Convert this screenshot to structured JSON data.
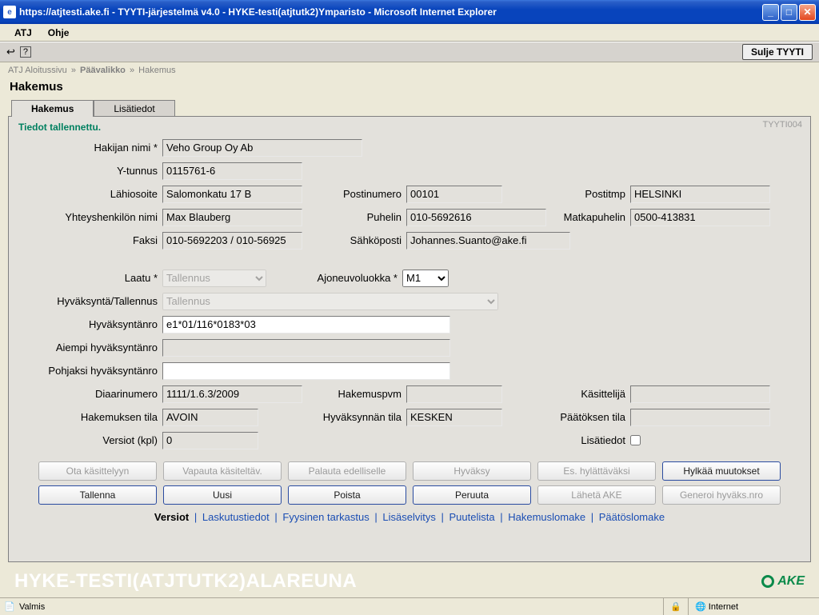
{
  "window": {
    "title": "https://atjtesti.ake.fi - TYYTI-järjestelmä v4.0 - HYKE-testi(atjtutk2)Ymparisto - Microsoft Internet Explorer"
  },
  "menu": {
    "atj": "ATJ",
    "ohje": "Ohje"
  },
  "toolbar": {
    "sulje": "Sulje TYYTI"
  },
  "breadcrumb": {
    "a": "ATJ Aloitussivu",
    "b": "Päävalikko",
    "c": "Hakemus"
  },
  "page": {
    "title": "Hakemus"
  },
  "tabs": {
    "hakemus": "Hakemus",
    "lisatiedot": "Lisätiedot"
  },
  "panel": {
    "status": "Tiedot tallennettu.",
    "id": "TYYTI004"
  },
  "labels": {
    "hakijan_nimi": "Hakijan nimi *",
    "ytunnus": "Y-tunnus",
    "lahiosoite": "Lähiosoite",
    "postinumero": "Postinumero",
    "postitmp": "Postitmp",
    "yhteyshenkilo": "Yhteyshenkilön nimi",
    "puhelin": "Puhelin",
    "matkapuhelin": "Matkapuhelin",
    "faksi": "Faksi",
    "sahkoposti": "Sähköposti",
    "laatu": "Laatu *",
    "ajoneuvoluokka": "Ajoneuvoluokka *",
    "hyvaksynta_tallennus": "Hyväksyntä/Tallennus",
    "hyvaksyntanro": "Hyväksyntänro",
    "aiempi": "Aiempi hyväksyntänro",
    "pohjaksi": "Pohjaksi hyväksyntänro",
    "diaarinumero": "Diaarinumero",
    "hakemuspvm": "Hakemuspvm",
    "kasittelija": "Käsittelijä",
    "hakemuksen_tila": "Hakemuksen tila",
    "hyvaksynnan_tila": "Hyväksynnän tila",
    "paatoksen_tila": "Päätöksen tila",
    "versiot": "Versiot (kpl)",
    "lisatiedot": "Lisätiedot"
  },
  "values": {
    "hakijan_nimi": "Veho Group Oy Ab",
    "ytunnus": "0115761-6",
    "lahiosoite": "Salomonkatu 17 B",
    "postinumero": "00101",
    "postitmp": "HELSINKI",
    "yhteyshenkilo": "Max Blauberg",
    "puhelin": "010-5692616",
    "matkapuhelin": "0500-413831",
    "faksi": "010-5692203 / 010-56925",
    "sahkoposti": "Johannes.Suanto@ake.fi",
    "laatu": "Tallennus",
    "ajoneuvoluokka": "M1",
    "hyvaksynta_tallennus": "Tallennus",
    "hyvaksyntanro": "e1*01/116*0183*03",
    "aiempi": "",
    "pohjaksi": "",
    "diaarinumero": "1111/1.6.3/2009",
    "hakemuspvm": "",
    "kasittelija": "",
    "hakemuksen_tila": "AVOIN",
    "hyvaksynnan_tila": "KESKEN",
    "paatoksen_tila": "",
    "versiot": "0"
  },
  "buttons": {
    "ota": "Ota käsittelyyn",
    "vapauta": "Vapauta käsiteltäv.",
    "palauta": "Palauta edelliselle",
    "hyvaksy": "Hyväksy",
    "es_hylat": "Es. hylättäväksi",
    "hylkaa": "Hylkää muutokset",
    "tallenna": "Tallenna",
    "uusi": "Uusi",
    "poista": "Poista",
    "peruuta": "Peruuta",
    "laheta": "Lähetä AKE",
    "generoi": "Generoi hyväks.nro"
  },
  "links": {
    "versiot": "Versiot",
    "laskutustiedot": "Laskutustiedot",
    "fyysinen": "Fyysinen tarkastus",
    "lisaselvitys": "Lisäselvitys",
    "puutelista": "Puutelista",
    "hakemuslomake": "Hakemuslomake",
    "paatoslomake": "Päätöslomake"
  },
  "footer": {
    "env": "HYKE-TESTI(ATJTUTK2)ALAREUNA",
    "brand": "AKE"
  },
  "statusbar": {
    "ready": "Valmis",
    "zone": "Internet"
  }
}
